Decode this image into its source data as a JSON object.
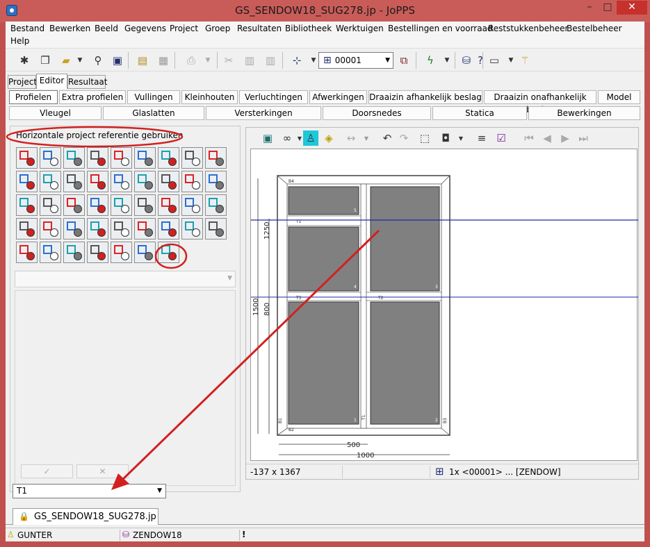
{
  "window": {
    "title": "GS_SENDOW18_SUG278.jp - JoPPS",
    "minimize": "–",
    "maximize": "□",
    "close": "✕"
  },
  "menu": [
    "Bestand",
    "Bewerken",
    "Beeld",
    "Gegevens",
    "Project",
    "Groep",
    "Resultaten",
    "Bibliotheek",
    "Werktuigen",
    "Bestellingen en voorraad",
    "Reststukkenbeheer",
    "Bestelbeheer",
    "Help"
  ],
  "toolbar": {
    "combo_value": "00001"
  },
  "main_tabs": [
    "Project",
    "Editor",
    "Resultaat"
  ],
  "editor_tabs_row1": [
    "Profielen",
    "Extra profielen",
    "Vullingen",
    "Kleinhouten",
    "Verluchtingen",
    "Afwerkingen",
    "Draaizin afhankelijk beslag",
    "Draaizin onafhankelijk beslag",
    "Model"
  ],
  "editor_tabs_row2": [
    "Vleugel",
    "Glaslatten",
    "Versterkingen",
    "Doorsnedes",
    "Statica",
    "Bewerkingen"
  ],
  "palette": {
    "header": "Horizontale project referentie gebruiken"
  },
  "drawing": {
    "dims": {
      "top": "1250",
      "mid": "800",
      "total": "1500",
      "bottom_half": "500",
      "bottom_total": "1000"
    },
    "labels": {
      "b4": "B4",
      "b2": "B2",
      "b1": "B1",
      "b3": "B3",
      "t1": "T1",
      "t1v": "T1",
      "t2": "T2",
      "t3": "T3",
      "p1": "1",
      "p2": "2",
      "p3": "3",
      "p4": "4",
      "p5": "5"
    }
  },
  "canvas_status": {
    "coords": "-137 x 1367",
    "info": "1x <00001> ... [ZENDOW]"
  },
  "bottom_combo": {
    "value": "T1"
  },
  "document_tab": "GS_SENDOW18_SUG278.jp",
  "statusbar": {
    "user": "GUNTER",
    "db": "ZENDOW18",
    "alert": "!"
  },
  "colors": {
    "title_bg": "#c95c59",
    "annotation": "#d22020",
    "guide": "#1a2aa8",
    "glass": "#808080"
  }
}
